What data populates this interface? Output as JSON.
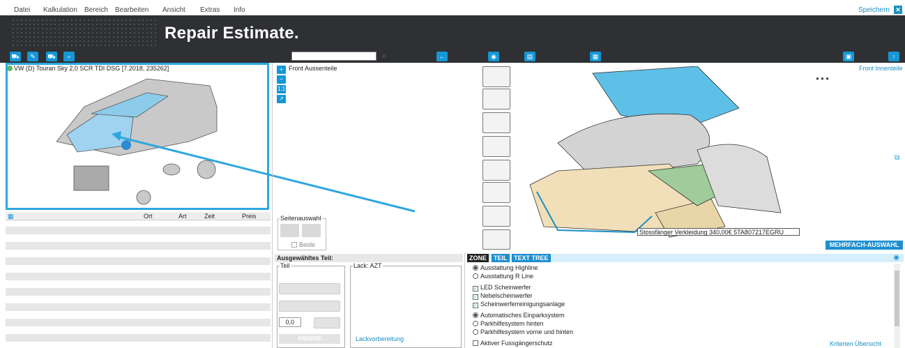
{
  "menu": {
    "items": [
      "Datei",
      "Kalkulation",
      "Bereich",
      "Bearbeiten",
      "Ansicht",
      "Extras",
      "Info"
    ],
    "save": "Speichern"
  },
  "banner": {
    "title": "Repair Estimate."
  },
  "vehicle": {
    "label": "VW (D) Touran Sky 2,0 SCR TDI DSG [7.2018, 235262]"
  },
  "list": {
    "columns": [
      "Ort",
      "Art",
      "Zeit",
      "Preis"
    ]
  },
  "graphic": {
    "left_label": "Front Aussenteile",
    "right_label": "Front Innenteile",
    "zoom": [
      "+",
      "−",
      "1:1",
      "↗"
    ]
  },
  "side_select": {
    "legend": "Seitenauswahl",
    "both": "Beide"
  },
  "multi_select": "MEHRFACH-AUSWAHL",
  "tooltip": "Stossfänger Verkleidung  340,00€    5TA807217EGRU",
  "selected_part": {
    "header": "Ausgewähltes Teil:",
    "teil_legend": "Teil",
    "lack_legend": "Lack: AZT",
    "qty": "0,0",
    "other": "ANDERE",
    "paint_prep": "Lackvorbereitung"
  },
  "zone": {
    "tabs": [
      "ZONE",
      "TEIL",
      "TEXT TREE"
    ],
    "criteria": [
      {
        "type": "radio",
        "checked": true,
        "label": "Ausstattung Highline"
      },
      {
        "type": "radio",
        "checked": false,
        "label": "Ausstattung R Line"
      },
      {
        "type": "check",
        "checked": true,
        "label": "LED Scheinwerfer"
      },
      {
        "type": "check",
        "checked": true,
        "label": "Nebelscheinwerfer"
      },
      {
        "type": "check",
        "checked": true,
        "label": "Scheinwerferreinigungsanlage"
      },
      {
        "type": "radio",
        "checked": true,
        "label": "Automatisches Einparksystem"
      },
      {
        "type": "radio",
        "checked": false,
        "label": "Parkhilfesystem hinten"
      },
      {
        "type": "radio",
        "checked": false,
        "label": "Parkhilfesystem vorne und hinten"
      },
      {
        "type": "check",
        "checked": false,
        "label": "Aktiver Fussgängerschutz"
      }
    ],
    "overview": "Kriterien Übersicht"
  },
  "colors": {
    "accent": "#1597d6",
    "banner": "#2e3033",
    "highlight": "#2ea7df"
  }
}
